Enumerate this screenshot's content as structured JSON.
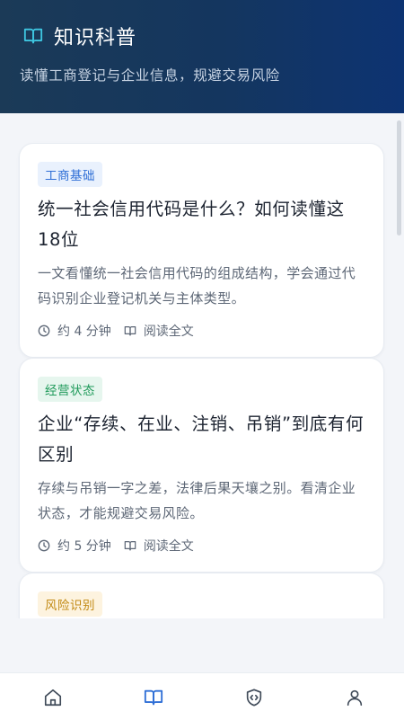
{
  "header": {
    "title": "知识科普",
    "subtitle": "读懂工商登记与企业信息，规避交易风险"
  },
  "articles": [
    {
      "tag": "工商基础",
      "tag_color": "#2f6fd6",
      "tag_bg": "#e9f1fd",
      "title": "统一社会信用代码是什么？如何读懂这18位",
      "desc": "一文看懂统一社会信用代码的组成结构，学会通过代码识别企业登记机关与主体类型。",
      "read_time": "约 4 分钟",
      "read_link": "阅读全文"
    },
    {
      "tag": "经营状态",
      "tag_color": "#1f9a5a",
      "tag_bg": "#e6f6ee",
      "title": "企业“存续、在业、注销、吊销”到底有何区别",
      "desc": "存续与吊销一字之差，法律后果天壤之别。看清企业状态，才能规避交易风险。",
      "read_time": "约 5 分钟",
      "read_link": "阅读全文"
    },
    {
      "tag": "风险识别",
      "tag_color": "#c28a14",
      "tag_bg": "#fdf3df"
    }
  ],
  "colors": {
    "header_bg": "#14365f",
    "icon_accent": "#3ec6e0",
    "nav_active": "#2f6fd6",
    "nav_inactive": "#3f4a58"
  },
  "nav": {
    "items": [
      "home-icon",
      "book-icon",
      "shield-code-icon",
      "user-icon"
    ],
    "active_index": 1
  }
}
